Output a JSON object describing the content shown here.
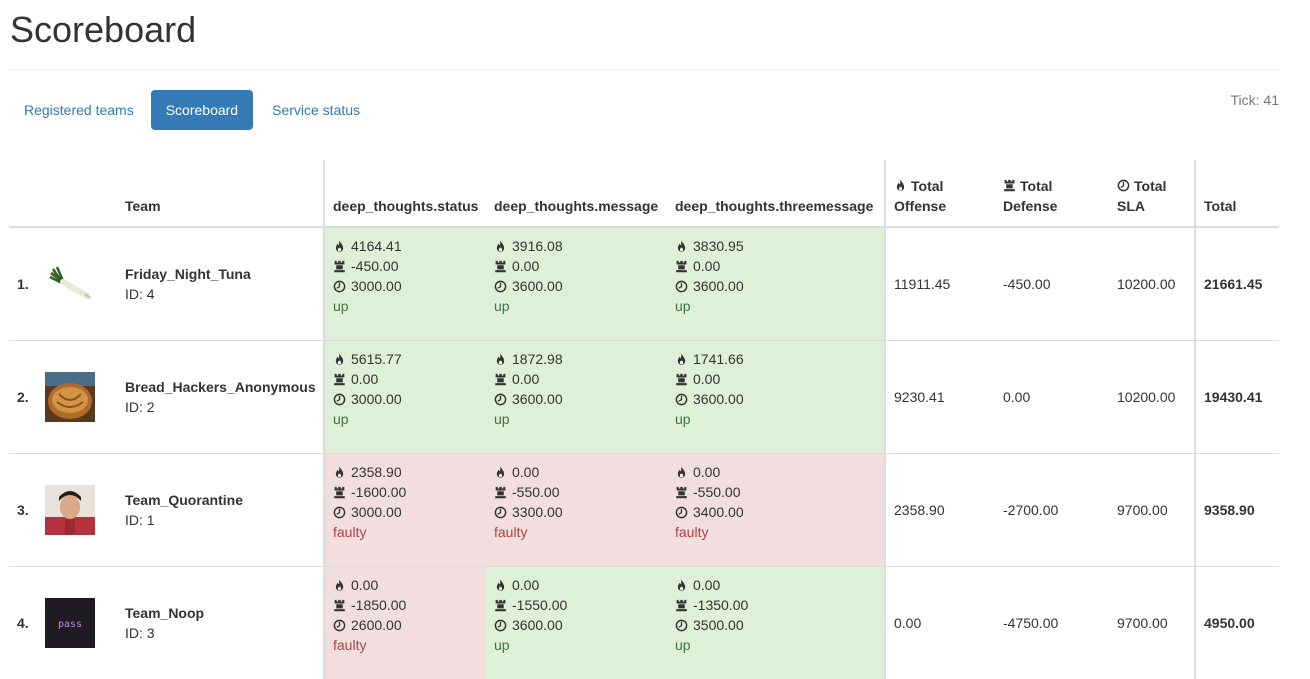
{
  "page": {
    "title": "Scoreboard",
    "tick": "Tick: 41"
  },
  "nav": [
    {
      "label": "Registered teams",
      "active": false
    },
    {
      "label": "Scoreboard",
      "active": true
    },
    {
      "label": "Service status",
      "active": false
    }
  ],
  "headers": {
    "team": "Team",
    "services": [
      "deep_thoughts.status",
      "deep_thoughts.message",
      "deep_thoughts.threemessage"
    ],
    "offense": "Total Offense",
    "defense": "Total Defense",
    "sla": "Total SLA",
    "total": "Total"
  },
  "icons": {
    "offense": "flame-icon",
    "defense": "rook-icon",
    "sla": "clock-icon"
  },
  "colors": {
    "up_bg": "#dff0d8",
    "up_text": "#3c763d",
    "faulty_bg": "#f2dede",
    "faulty_text": "#a94442",
    "link": "#337ab7"
  },
  "rows": [
    {
      "rank": "1.",
      "avatar": "leek-image",
      "name": "Friday_Night_Tuna",
      "id": "ID: 4",
      "services": [
        {
          "offense": "4164.41",
          "defense": "-450.00",
          "sla": "3000.00",
          "status": "up"
        },
        {
          "offense": "3916.08",
          "defense": "0.00",
          "sla": "3600.00",
          "status": "up"
        },
        {
          "offense": "3830.95",
          "defense": "0.00",
          "sla": "3600.00",
          "status": "up"
        }
      ],
      "total_offense": "11911.45",
      "total_defense": "-450.00",
      "total_sla": "10200.00",
      "total": "21661.45"
    },
    {
      "rank": "2.",
      "avatar": "bread-image",
      "name": "Bread_Hackers_Anonymous",
      "id": "ID: 2",
      "services": [
        {
          "offense": "5615.77",
          "defense": "0.00",
          "sla": "3000.00",
          "status": "up"
        },
        {
          "offense": "1872.98",
          "defense": "0.00",
          "sla": "3600.00",
          "status": "up"
        },
        {
          "offense": "1741.66",
          "defense": "0.00",
          "sla": "3600.00",
          "status": "up"
        }
      ],
      "total_offense": "9230.41",
      "total_defense": "0.00",
      "total_sla": "10200.00",
      "total": "19430.41"
    },
    {
      "rank": "3.",
      "avatar": "person-image",
      "name": "Team_Quorantine",
      "id": "ID: 1",
      "services": [
        {
          "offense": "2358.90",
          "defense": "-1600.00",
          "sla": "3000.00",
          "status": "faulty"
        },
        {
          "offense": "0.00",
          "defense": "-550.00",
          "sla": "3300.00",
          "status": "faulty"
        },
        {
          "offense": "0.00",
          "defense": "-550.00",
          "sla": "3400.00",
          "status": "faulty"
        }
      ],
      "total_offense": "2358.90",
      "total_defense": "-2700.00",
      "total_sla": "9700.00",
      "total": "9358.90"
    },
    {
      "rank": "4.",
      "avatar": "terminal-image",
      "avatar_text": "pass",
      "name": "Team_Noop",
      "id": "ID: 3",
      "services": [
        {
          "offense": "0.00",
          "defense": "-1850.00",
          "sla": "2600.00",
          "status": "faulty"
        },
        {
          "offense": "0.00",
          "defense": "-1550.00",
          "sla": "3600.00",
          "status": "up"
        },
        {
          "offense": "0.00",
          "defense": "-1350.00",
          "sla": "3500.00",
          "status": "up"
        }
      ],
      "total_offense": "0.00",
      "total_defense": "-4750.00",
      "total_sla": "9700.00",
      "total": "4950.00"
    }
  ]
}
